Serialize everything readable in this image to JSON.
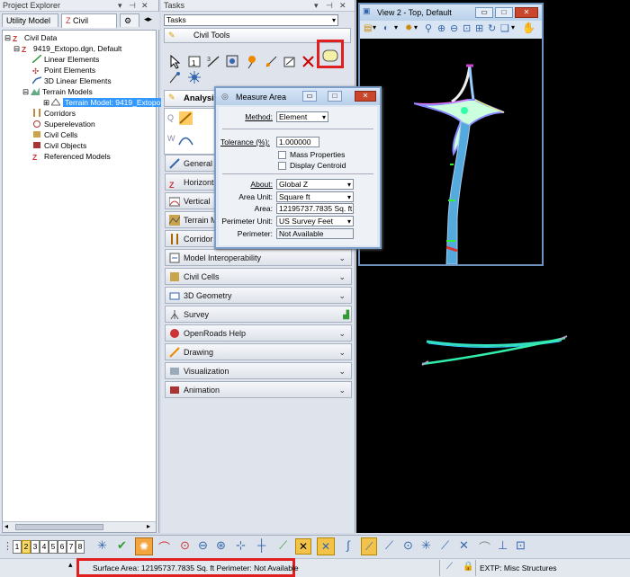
{
  "project_explorer": {
    "title": "Project Explorer",
    "tabs": [
      "Utility Model",
      "Civil Model"
    ],
    "tree": [
      {
        "label": "Civil Data"
      },
      {
        "label": "9419_Extopo.dgn, Default"
      },
      {
        "label": "Linear Elements"
      },
      {
        "label": "Point Elements"
      },
      {
        "label": "3D Linear Elements"
      },
      {
        "label": "Terrain Models"
      },
      {
        "label": "Terrain Model: 9419_Extopo"
      },
      {
        "label": "Corridors"
      },
      {
        "label": "Superelevation"
      },
      {
        "label": "Civil Cells"
      },
      {
        "label": "Civil Objects"
      },
      {
        "label": "Referenced Models"
      }
    ]
  },
  "tasks": {
    "title": "Tasks",
    "dropdown": "Tasks",
    "civil_tools": "Civil Tools",
    "analysis_label": "Analysis",
    "sections": [
      "General",
      "Horizontal",
      "Vertical",
      "Terrain M",
      "Corridor",
      "Model Interoperability",
      "Civil Cells",
      "3D Geometry",
      "Survey",
      "OpenRoads Help",
      "Drawing",
      "Visualization",
      "Animation"
    ]
  },
  "measure_area": {
    "title": "Measure Area",
    "method_label": "Method:",
    "method_value": "Element",
    "tolerance_label": "Tolerance (%):",
    "tolerance_value": "1.000000",
    "mass_properties": "Mass Properties",
    "display_centroid": "Display Centroid",
    "about_label": "About:",
    "about_value": "Global Z",
    "area_unit_label": "Area Unit:",
    "area_unit_value": "Square ft",
    "area_label": "Area:",
    "area_value": "12195737.7835 Sq. ft",
    "perimeter_unit_label": "Perimeter Unit:",
    "perimeter_unit_value": "US Survey Feet",
    "perimeter_label": "Perimeter:",
    "perimeter_value": "Not Available"
  },
  "view": {
    "title": "View 2 - Top, Default"
  },
  "bottom_toolbar": {
    "views": [
      "1",
      "2",
      "3",
      "4",
      "5",
      "6",
      "7",
      "8"
    ]
  },
  "status": {
    "message": "Surface Area: 12195737.7835 Sq. ft Perimeter: Not Available",
    "level": "EXTP: Misc Structures"
  },
  "colors": {
    "highlight": "#e02020",
    "selection": "#3399ff",
    "canvas": "#000000"
  }
}
